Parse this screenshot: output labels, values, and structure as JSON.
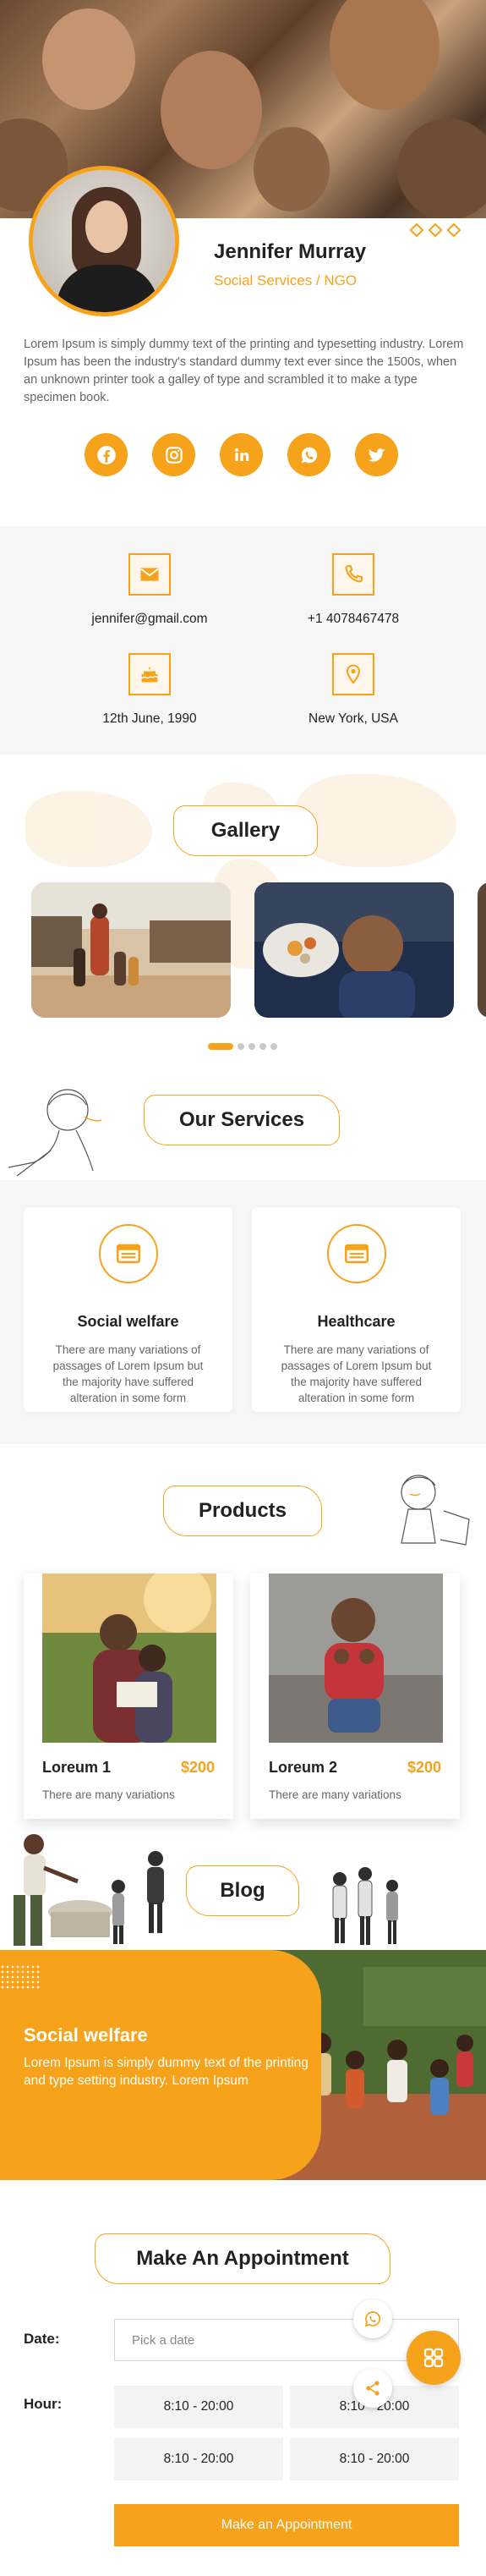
{
  "colors": {
    "accent": "#f7a21b",
    "text": "#222222",
    "muted": "#666666",
    "panel": "#f6f6f6"
  },
  "profile": {
    "name": "Jennifer Murray",
    "role": "Social Services / NGO",
    "bio": "Lorem Ipsum is simply dummy text of the printing and typesetting industry. Lorem Ipsum has been the industry's standard dummy text ever since the 1500s, when an unknown printer took a galley of type and scrambled it to make a type specimen book."
  },
  "socials": [
    {
      "icon": "facebook-icon"
    },
    {
      "icon": "instagram-icon"
    },
    {
      "icon": "linkedin-icon"
    },
    {
      "icon": "whatsapp-icon"
    },
    {
      "icon": "twitter-icon"
    }
  ],
  "contact": {
    "email": "jennifer@gmail.com",
    "phone": "+1 4078467478",
    "birthday": "12th June, 1990",
    "location": "New York, USA"
  },
  "gallery": {
    "title": "Gallery",
    "slide_count": 5,
    "active_slide": 1
  },
  "services": {
    "title": "Our Services",
    "items": [
      {
        "title": "Social welfare",
        "desc": "There are many variations of passages of Lorem Ipsum but the majority have suffered alteration in some form",
        "icon": "id-card-icon"
      },
      {
        "title": "Healthcare",
        "desc": "There are many variations of passages of Lorem Ipsum but the majority have suffered alteration in some form",
        "icon": "id-card-icon"
      }
    ]
  },
  "products": {
    "title": "Products",
    "items": [
      {
        "name": "Loreum 1",
        "price": "$200",
        "desc": "There are many variations"
      },
      {
        "name": "Loreum 2",
        "price": "$200",
        "desc": "There are many variations"
      }
    ]
  },
  "blog": {
    "title": "Blog",
    "post_title": "Social welfare",
    "post_text": "Lorem Ipsum is simply dummy text of the printing and type setting industry. Lorem Ipsum"
  },
  "appointment": {
    "title": "Make An Appointment",
    "date_label": "Date:",
    "date_placeholder": "Pick a date",
    "hour_label": "Hour:",
    "slots": [
      "8:10 - 20:00",
      "8:10 - 20:00",
      "8:10 - 20:00",
      "8:10 - 20:00"
    ],
    "button": "Make an Appointment"
  }
}
